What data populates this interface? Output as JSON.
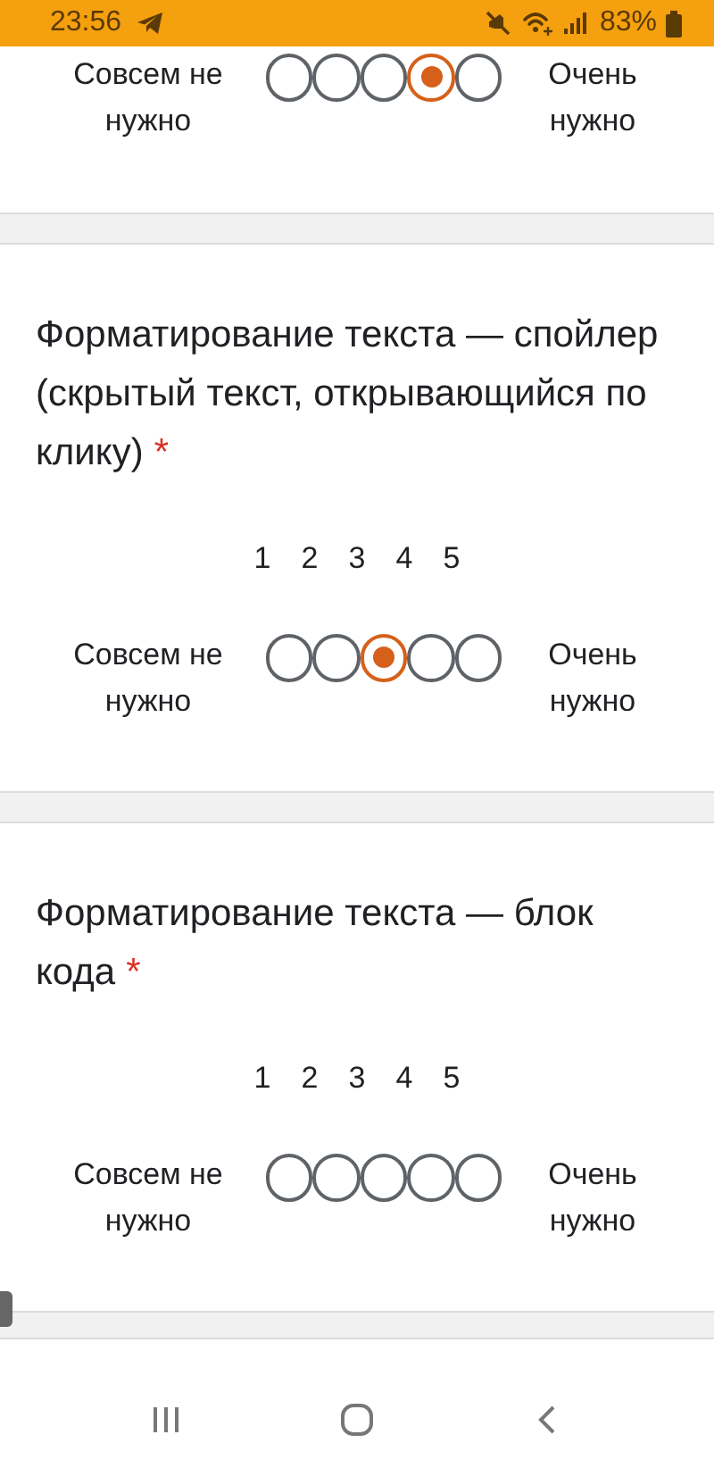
{
  "status_bar": {
    "time": "23:56",
    "battery": "83%"
  },
  "questions": [
    {
      "low_label": "Совсем не нужно",
      "high_label": "Очень нужно",
      "options": [
        {
          "selected": false
        },
        {
          "selected": false
        },
        {
          "selected": false
        },
        {
          "selected": true
        },
        {
          "selected": false
        }
      ]
    },
    {
      "title": "Форматирование текста — спойлер (скрытый текст, открывающийся по клику)",
      "required_mark": "*",
      "scale_numbers": [
        "1",
        "2",
        "3",
        "4",
        "5"
      ],
      "low_label": "Совсем не нужно",
      "high_label": "Очень нужно",
      "options": [
        {
          "selected": false
        },
        {
          "selected": false
        },
        {
          "selected": true
        },
        {
          "selected": false
        },
        {
          "selected": false
        }
      ]
    },
    {
      "title": "Форматирование текста — блок кода",
      "required_mark": "*",
      "scale_numbers": [
        "1",
        "2",
        "3",
        "4",
        "5"
      ],
      "low_label": "Совсем не нужно",
      "high_label": "Очень нужно",
      "options": [
        {
          "selected": false
        },
        {
          "selected": false
        },
        {
          "selected": false
        },
        {
          "selected": false
        },
        {
          "selected": false
        }
      ]
    }
  ]
}
